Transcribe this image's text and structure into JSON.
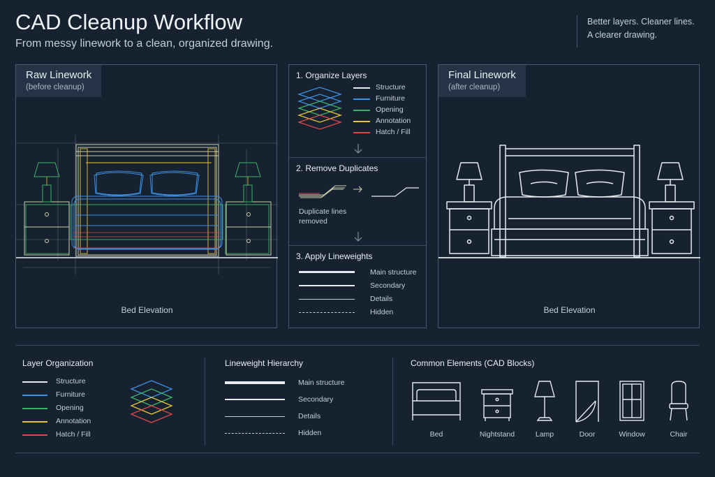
{
  "header": {
    "title": "CAD Cleanup Workflow",
    "subtitle": "From messy linework to a clean, organized drawing.",
    "tagline_line1": "Better layers. Cleaner lines.",
    "tagline_line2": "A clearer drawing."
  },
  "raw_panel": {
    "title": "Raw Linework",
    "subtitle": "(before cleanup)",
    "caption": "Bed Elevation"
  },
  "final_panel": {
    "title": "Final Linework",
    "subtitle": "(after cleanup)",
    "caption": "Bed Elevation"
  },
  "steps": {
    "step1": {
      "title": "1. Organize Layers",
      "layers": [
        {
          "name": "Structure",
          "color": "#e6ebf0"
        },
        {
          "name": "Furniture",
          "color": "#3d8fe0"
        },
        {
          "name": "Opening",
          "color": "#3db06a"
        },
        {
          "name": "Annotation",
          "color": "#e6c53a"
        },
        {
          "name": "Hatch / Fill",
          "color": "#e04848"
        }
      ]
    },
    "step2": {
      "title": "2. Remove Duplicates",
      "note_line1": "Duplicate lines",
      "note_line2": "removed"
    },
    "step3": {
      "title": "3. Apply Lineweights",
      "weights": [
        "Main structure",
        "Secondary",
        "Details",
        "Hidden"
      ]
    }
  },
  "bottom": {
    "layer_org": {
      "title": "Layer Organization",
      "items": [
        {
          "name": "Structure",
          "color": "#e6ebf0"
        },
        {
          "name": "Furniture",
          "color": "#3d8fe0"
        },
        {
          "name": "Opening",
          "color": "#3db06a"
        },
        {
          "name": "Annotation",
          "color": "#e6c53a"
        },
        {
          "name": "Hatch / Fill",
          "color": "#e04848"
        }
      ]
    },
    "lineweight": {
      "title": "Lineweight Hierarchy",
      "items": [
        "Main structure",
        "Secondary",
        "Details",
        "Hidden"
      ]
    },
    "blocks": {
      "title": "Common Elements (CAD Blocks)",
      "items": [
        "Bed",
        "Nightstand",
        "Lamp",
        "Door",
        "Window",
        "Chair"
      ]
    }
  },
  "icons": [
    "layer-stack-icon",
    "arrow-down-icon",
    "arrow-right-icon",
    "bed-icon",
    "nightstand-icon",
    "lamp-icon",
    "door-icon",
    "window-icon",
    "chair-icon"
  ]
}
